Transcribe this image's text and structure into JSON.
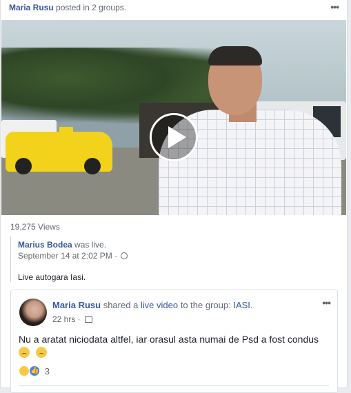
{
  "header": {
    "author": "Maria Rusu",
    "action": "posted in 2 groups.",
    "more_icon": "more-dots-icon"
  },
  "video": {
    "play_icon": "play-icon",
    "views": "19,275 Views"
  },
  "shared": {
    "author": "Marius Bodea",
    "action": "was live.",
    "timestamp": "September 14 at 2:02 PM · ",
    "privacy_icon": "globe-icon",
    "text": "Live autogara Iasi."
  },
  "inner_post": {
    "author": "Maria Rusu",
    "action_prefix": "shared a ",
    "action_link": "live video",
    "action_mid": " to the group: ",
    "group": "IASI",
    "group_suffix": ".",
    "time": "22 hrs · ",
    "audience_icon": "group-icon",
    "text": "Nu a aratat niciodata altfel, iar orasul asta numai de Psd a fost condus",
    "emojis": [
      "disappointed-face",
      "disappointed-face"
    ],
    "reactions": [
      "sad",
      "like"
    ],
    "reaction_count": "3",
    "more_dots": "•••"
  },
  "colors": {
    "link": "#385898",
    "meta": "#606770",
    "like_blue": "#4080ff"
  }
}
